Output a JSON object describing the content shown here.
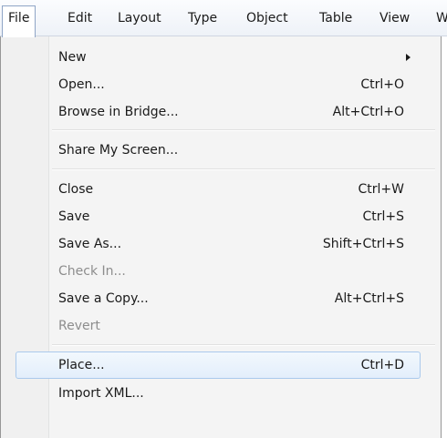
{
  "menubar": {
    "items": [
      {
        "label": "File",
        "active": true
      },
      {
        "label": "Edit"
      },
      {
        "label": "Layout"
      },
      {
        "label": "Type"
      },
      {
        "label": "Object"
      },
      {
        "label": "Table"
      },
      {
        "label": "View"
      },
      {
        "label": "W"
      }
    ]
  },
  "file_menu": {
    "items": [
      {
        "label": "New",
        "shortcut": "",
        "submenu": true
      },
      {
        "label": "Open...",
        "shortcut": "Ctrl+O"
      },
      {
        "label": "Browse in Bridge...",
        "shortcut": "Alt+Ctrl+O"
      },
      {
        "label": "Share My Screen...",
        "shortcut": ""
      },
      {
        "label": "Close",
        "shortcut": "Ctrl+W"
      },
      {
        "label": "Save",
        "shortcut": "Ctrl+S"
      },
      {
        "label": "Save As...",
        "shortcut": "Shift+Ctrl+S"
      },
      {
        "label": "Check In...",
        "shortcut": "",
        "disabled": true
      },
      {
        "label": "Save a Copy...",
        "shortcut": "Alt+Ctrl+S"
      },
      {
        "label": "Revert",
        "shortcut": "",
        "disabled": true
      },
      {
        "label": "Place...",
        "shortcut": "Ctrl+D",
        "highlighted": true
      },
      {
        "label": "Import XML...",
        "shortcut": ""
      }
    ]
  },
  "colors": {
    "highlight_border": "#aac9ec",
    "disabled_text": "#8d8d8d",
    "menu_background": "#f4f4f4"
  }
}
